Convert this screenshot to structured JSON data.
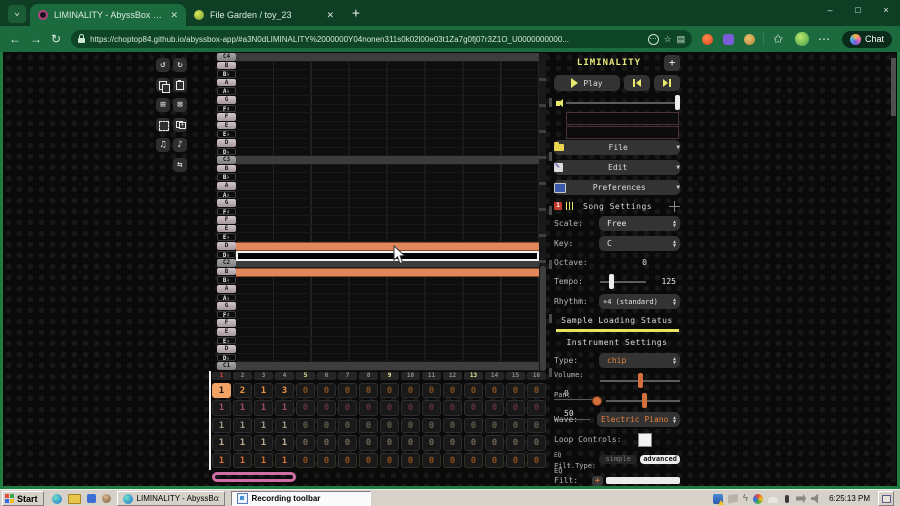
{
  "browser": {
    "tabs": [
      {
        "title": "LIMINALITY - AbyssBox 1.7"
      },
      {
        "title": "File Garden / toy_23"
      }
    ],
    "new_tab": "+",
    "url": "https://choptop84.github.io/abyssbox-app/#a3N0dLIMINALITY%2000000Y04nonen311s0k02l00e03t1Za7g0fj07r3Z1O_U0000000000...",
    "chat_label": "Chat",
    "window_controls": {
      "minimize": "–",
      "maximize": "□",
      "close": "×"
    }
  },
  "app": {
    "toolbar": {
      "buttons": [
        {
          "name": "undo",
          "glyph": "↺"
        },
        {
          "name": "redo",
          "glyph": "↻"
        },
        {
          "name": "copy",
          "glyph": ""
        },
        {
          "name": "paste",
          "glyph": ""
        },
        {
          "name": "insert-bar",
          "glyph": "⊞"
        },
        {
          "name": "delete-bar",
          "glyph": "⊠"
        },
        {
          "name": "select-all",
          "glyph": ""
        },
        {
          "name": "duplicate",
          "glyph": ""
        },
        {
          "name": "notes-down",
          "glyph": "♫"
        },
        {
          "name": "notes-up",
          "glyph": "♪"
        },
        {
          "name": "loop",
          "glyph": "⇆"
        }
      ]
    },
    "piano": {
      "keys": [
        "C4",
        "B",
        "B♭",
        "A",
        "A♭",
        "G",
        "F♯",
        "F",
        "E",
        "E♭",
        "D",
        "D♭",
        "C3",
        "B",
        "B♭",
        "A",
        "A♭",
        "G",
        "F♯",
        "F",
        "E",
        "E♭",
        "D",
        "D♭",
        "C2",
        "B",
        "B♭",
        "A",
        "A♭",
        "G",
        "F♯",
        "F",
        "E",
        "E♭",
        "D",
        "D♭",
        "C1"
      ]
    },
    "roll": {
      "notes": [
        {
          "row": 22
        },
        {
          "row": 25
        }
      ],
      "hover_row": 23,
      "note_color": "#e0875c"
    },
    "ruler": {
      "beats": [
        "1",
        "2",
        "3",
        "4",
        "5",
        "6",
        "7",
        "8",
        "9",
        "10",
        "11",
        "12",
        "13",
        "14",
        "15",
        "16"
      ]
    },
    "pattern": {
      "rows": [
        {
          "channel": "pitch-1",
          "cells": [
            "1",
            "2",
            "1",
            "3",
            "0",
            "0",
            "0",
            "0",
            "0",
            "0",
            "0",
            "0",
            "0",
            "0",
            "0",
            "0"
          ],
          "selected": 0
        },
        {
          "channel": "pitch-2",
          "cells": [
            "1",
            "1",
            "1",
            "1",
            "0",
            "0",
            "0",
            "0",
            "0",
            "0",
            "0",
            "0",
            "0",
            "0",
            "0",
            "0"
          ],
          "selected": -1
        },
        {
          "channel": "pitch-3",
          "cells": [
            "1",
            "1",
            "1",
            "1",
            "0",
            "0",
            "0",
            "0",
            "0",
            "0",
            "0",
            "0",
            "0",
            "0",
            "0",
            "0"
          ],
          "selected": -1
        },
        {
          "channel": "pitch-4",
          "cells": [
            "1",
            "1",
            "1",
            "1",
            "0",
            "0",
            "0",
            "0",
            "0",
            "0",
            "0",
            "0",
            "0",
            "0",
            "0",
            "0"
          ],
          "selected": -1
        },
        {
          "channel": "noise-1",
          "cells": [
            "1",
            "1",
            "1",
            "1",
            "0",
            "0",
            "0",
            "0",
            "0",
            "0",
            "0",
            "0",
            "0",
            "0",
            "0",
            "0"
          ],
          "selected": -1
        }
      ]
    },
    "sidebar": {
      "title": "LIMINALITY",
      "add_channel": "+",
      "play_label": "Play",
      "menus": [
        {
          "label": "File"
        },
        {
          "label": "Edit"
        },
        {
          "label": "Preferences"
        }
      ],
      "song_settings": {
        "header": "Song Settings",
        "scale_label": "Scale:",
        "scale_value": "Free",
        "key_label": "Key:",
        "key_value": "C",
        "octave_label": "Octave:",
        "octave_value": "0",
        "tempo_label": "Tempo:",
        "tempo_value": "125",
        "rhythm_label": "Rhythm:",
        "rhythm_value": "÷4 (standard)"
      },
      "sample_loading_header": "Sample Loading Status",
      "instrument": {
        "header": "Instrument Settings",
        "type_label": "Type:",
        "type_value": "chip",
        "volume_label": "Volume:",
        "volume_value": "0",
        "pan_label": "Pan:",
        "pan_value": "50",
        "wave_label": "Wave:",
        "wave_value": "Electric Piano",
        "loop_label": "Loop Controls:",
        "eq_label": "EQ",
        "filt_type_label": "Filt.Type:",
        "simple_label": "simple",
        "advanced_label": "advanced",
        "eq2_label": "EQ",
        "filt_label": "Filt:"
      },
      "accent_yellow": "#e8e87a",
      "accent_orange": "#e8813c"
    }
  },
  "taskbar": {
    "start_label": "Start",
    "task_buttons": [
      {
        "label": "LIMINALITY - AbyssBox 1..."
      },
      {
        "label": "Recording toolbar"
      }
    ],
    "tray_icons": [
      "network-warning-icon",
      "no-signal-icon",
      "power-bolt-icon",
      "drive-pinwheel-icon",
      "cloud-icon",
      "microphone-icon",
      "plug-icon",
      "speaker-icon"
    ],
    "time": "6:25:13 PM"
  }
}
